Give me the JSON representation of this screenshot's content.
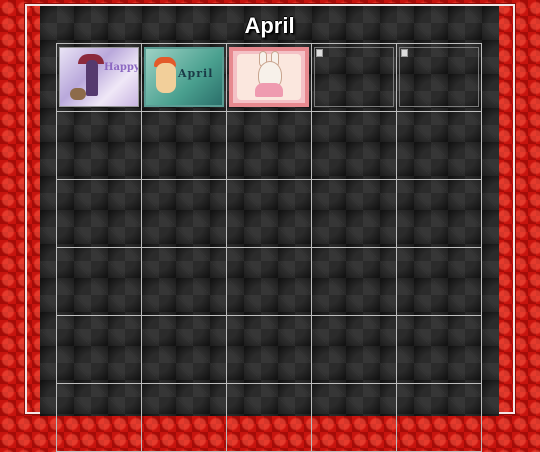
{
  "title": "April",
  "grid": {
    "columns": 5,
    "rows": 6,
    "thumbnails": [
      {
        "name": "thumb-woman-umbrella",
        "text": "Happy",
        "state": "loaded"
      },
      {
        "name": "thumb-girl-april",
        "text": "April",
        "state": "loaded"
      },
      {
        "name": "thumb-bunny",
        "text": "",
        "state": "loaded"
      },
      {
        "name": "thumb-broken-1",
        "text": "",
        "state": "broken"
      },
      {
        "name": "thumb-broken-2",
        "text": "",
        "state": "broken"
      }
    ]
  },
  "colors": {
    "page_background": "#c8140e",
    "panel_background": "#1b1b1b",
    "cell_border": "#bdbdbd",
    "title_text": "#ffffff"
  }
}
